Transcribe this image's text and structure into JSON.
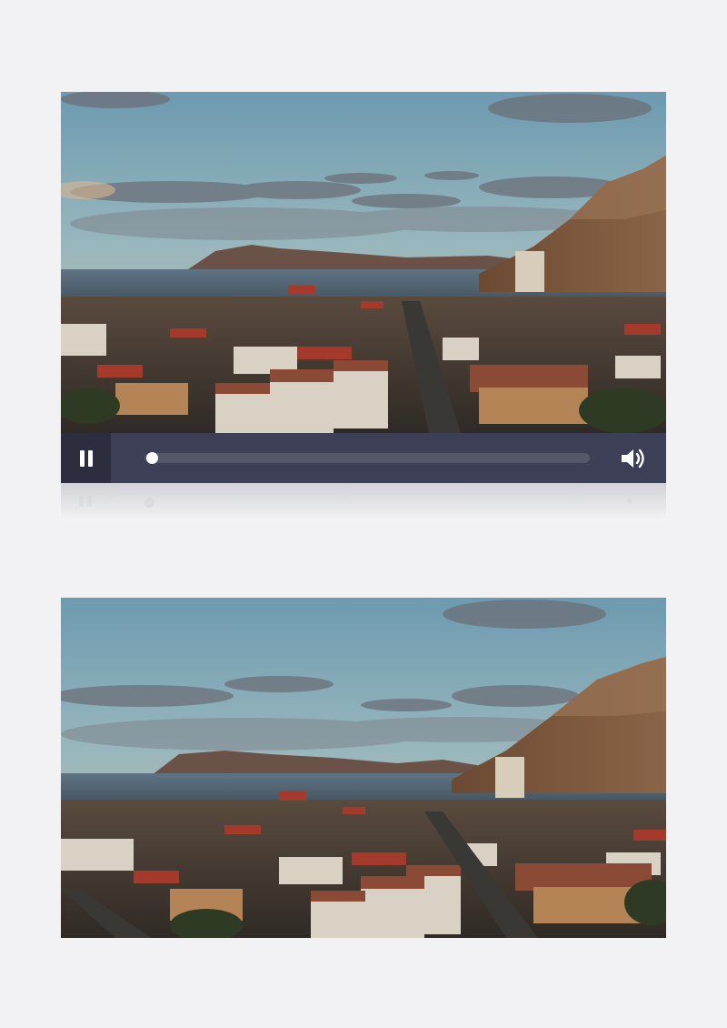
{
  "player": {
    "state": "playing",
    "progress": 0.0,
    "play_pause_icon": "pause-icon",
    "volume_icon": "volume-icon"
  },
  "scene": {
    "description_icon": "coastal-town-aerial-image"
  },
  "colors": {
    "page_background": "#f2f2f4",
    "control_bar": "#3c3f55",
    "control_button_bg": "#2c2e40",
    "track": "#545868"
  }
}
